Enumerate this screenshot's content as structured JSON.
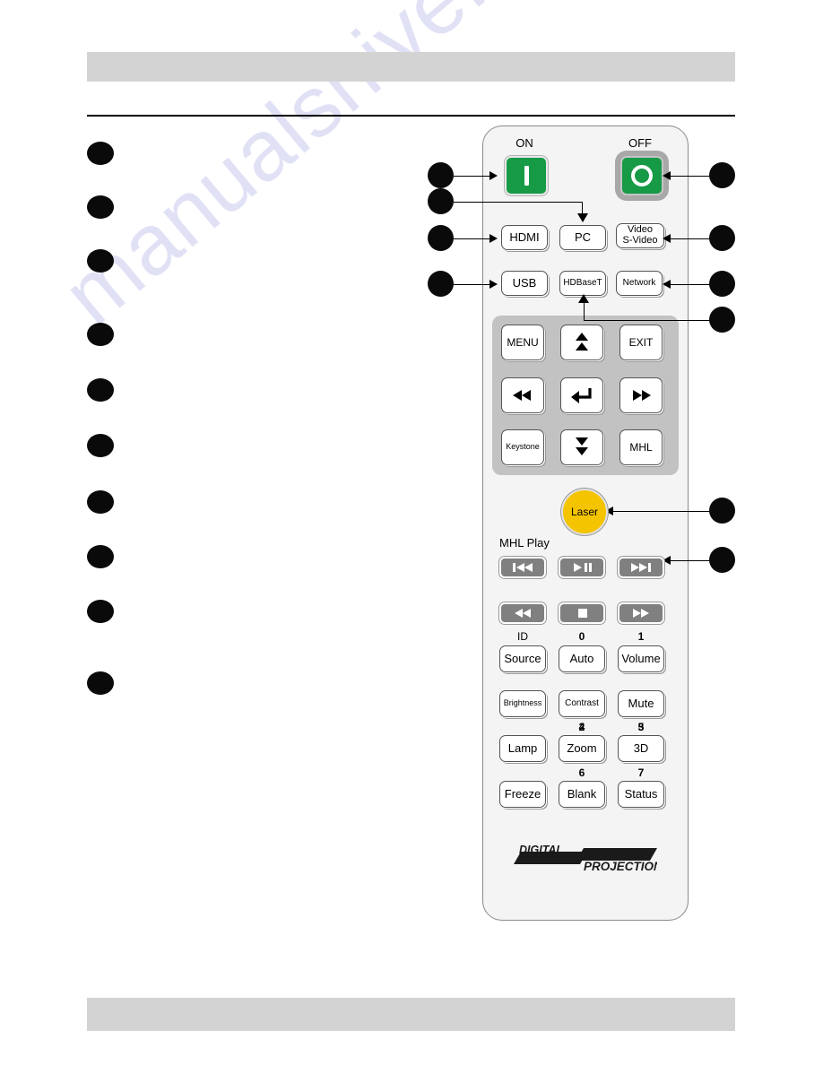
{
  "document": {
    "watermark": "manualshive.com",
    "header_band": "",
    "footer_band": ""
  },
  "remote": {
    "brand_line1": "DIGITAL",
    "brand_line2": "PROJECTION",
    "power": {
      "on_label": "ON",
      "off_label": "OFF",
      "on_icon": "power-on-bar-icon",
      "off_icon": "power-off-circle-icon",
      "green": "#179a46"
    },
    "source_keys": [
      {
        "label": "HDMI",
        "name": "hdmi-button"
      },
      {
        "label": "PC",
        "name": "pc-button"
      },
      {
        "label": "Video\nS-Video",
        "line1": "Video",
        "line2": "S-Video",
        "name": "video-svideo-button"
      },
      {
        "label": "USB",
        "name": "usb-button"
      },
      {
        "label": "HDBaseT",
        "name": "hdbaset-button"
      },
      {
        "label": "Network",
        "name": "network-button"
      }
    ],
    "nav_keys": [
      {
        "label": "MENU",
        "name": "menu-button"
      },
      {
        "label": "",
        "name": "up-button",
        "icon": "double-up-arrow-icon"
      },
      {
        "label": "EXIT",
        "name": "exit-button"
      },
      {
        "label": "",
        "name": "left-button",
        "icon": "double-left-arrow-icon"
      },
      {
        "label": "",
        "name": "enter-button",
        "icon": "enter-return-icon"
      },
      {
        "label": "",
        "name": "right-button",
        "icon": "double-right-arrow-icon"
      },
      {
        "label": "Keystone",
        "name": "keystone-button"
      },
      {
        "label": "",
        "name": "down-button",
        "icon": "double-down-arrow-icon"
      },
      {
        "label": "MHL",
        "name": "mhl-button"
      }
    ],
    "laser": {
      "label": "Laser",
      "color": "#f5c400"
    },
    "mhl_play_label": "MHL  Play",
    "media_keys_row1": [
      {
        "name": "previous-track-button",
        "icon": "skip-back-icon"
      },
      {
        "name": "play-pause-button",
        "icon": "play-pause-icon"
      },
      {
        "name": "next-track-button",
        "icon": "skip-forward-icon"
      }
    ],
    "media_keys_row2": [
      {
        "name": "rewind-button",
        "icon": "rewind-icon"
      },
      {
        "name": "stop-button",
        "icon": "stop-icon"
      },
      {
        "name": "fast-forward-button",
        "icon": "fast-forward-icon"
      }
    ],
    "function_grid": [
      {
        "num": "ID",
        "label": "Source",
        "name": "source-button",
        "num_bold": false
      },
      {
        "num": "0",
        "label": "Auto",
        "name": "auto-button",
        "num_bold": true
      },
      {
        "num": "1",
        "label": "Volume",
        "name": "volume-button",
        "num_bold": true
      },
      {
        "num": "",
        "label": "Brightness",
        "name": "brightness-button",
        "num_bold": false
      },
      {
        "num": "2",
        "label": "Contrast",
        "name": "contrast-button",
        "num_bold": true
      },
      {
        "num": "3",
        "label": "Mute",
        "name": "mute-button",
        "num_bold": true
      },
      {
        "num": "",
        "label": "Lamp",
        "name": "lamp-button",
        "num_bold": false
      },
      {
        "num": "4",
        "label": "Zoom",
        "name": "zoom-button",
        "num_bold": true
      },
      {
        "num": "5",
        "label": "3D",
        "name": "three-d-button",
        "num_bold": true
      },
      {
        "num": "",
        "label": "Freeze",
        "name": "freeze-button",
        "num_bold": false
      },
      {
        "num": "6",
        "label": "Blank",
        "name": "blank-button",
        "num_bold": true
      },
      {
        "num": "7",
        "label": "Status",
        "name": "status-button",
        "num_bold": true
      }
    ]
  },
  "callouts": {
    "left_column": [
      "",
      "",
      "",
      "",
      "",
      "",
      "",
      "",
      "",
      ""
    ],
    "inner_left": [
      "",
      "",
      "",
      ""
    ],
    "right_column": [
      "",
      "",
      "",
      "",
      "",
      ""
    ]
  }
}
